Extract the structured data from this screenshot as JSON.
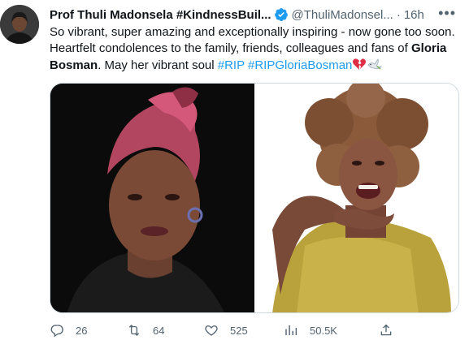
{
  "author": {
    "display_name": "Prof Thuli Madonsela #KindnessBuil...",
    "handle": "@ThuliMadonsel...",
    "separator": "·",
    "timestamp": "16h",
    "more_icon": "more-icon"
  },
  "tweet": {
    "text_1": "So vibrant, super amazing and exceptionally inspiring - now gone too soon. Heartfelt condolences to the family, friends, colleagues and fans of ",
    "bold_name": "Gloria Bosman",
    "text_2": ". May her vibrant soul ",
    "hashtag_1": "#RIP",
    "hashtag_2": "#RIPGloriaBosman",
    "emojis": [
      "broken-heart-icon",
      "dove-icon"
    ]
  },
  "actions": {
    "reply_count": "26",
    "retweet_count": "64",
    "like_count": "525",
    "views_count": "50.5K"
  },
  "colors": {
    "link": "#1d9bf0",
    "verified": "#1d9bf0",
    "muted": "#536471",
    "text": "#0f1419"
  }
}
